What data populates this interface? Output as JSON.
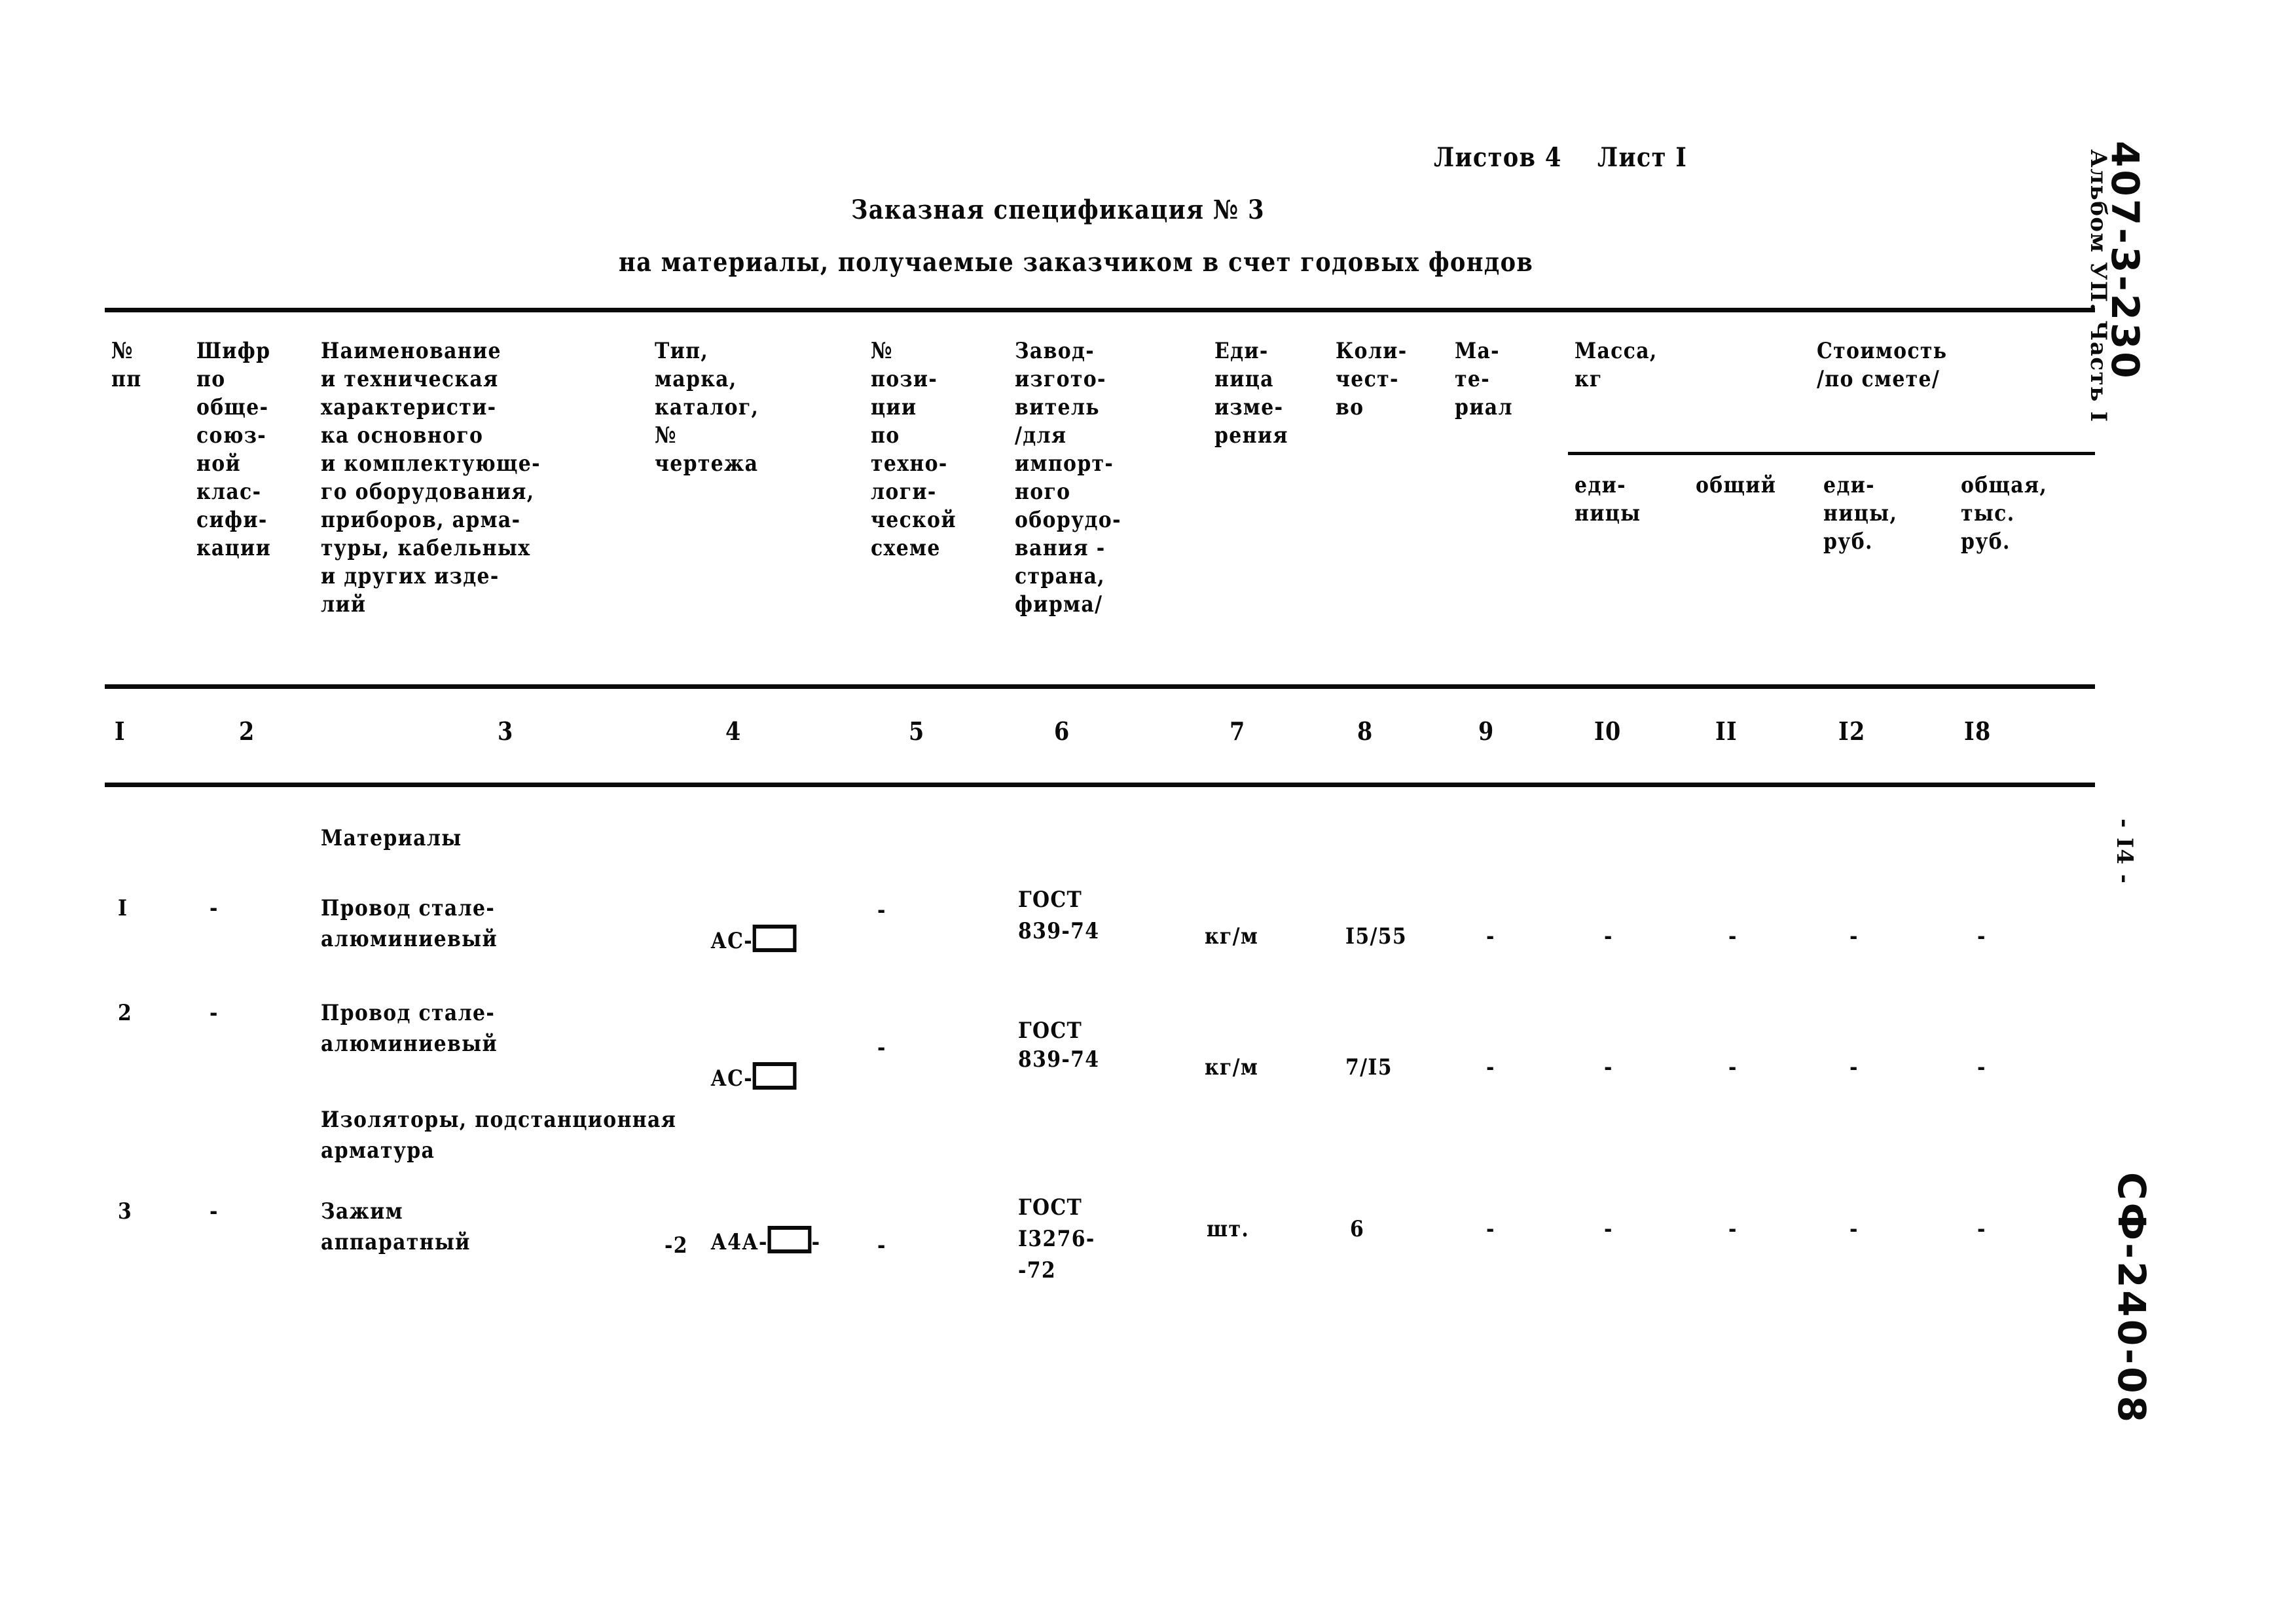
{
  "document": {
    "sheet_info": "Листов 4    Лист I",
    "title_line1": "Заказная спецификация № 3",
    "title_line2": "на материалы, получаемые заказчиком в счет годовых фондов"
  },
  "margin": {
    "album_code_handwritten": "407-3-230",
    "album_label": "Альбом УП. Часть I",
    "page_number": "- I4 -",
    "stamp_handwritten": "СФ-240-08"
  },
  "table": {
    "headers": [
      {
        "num": "I",
        "lines": [
          "№",
          "пп"
        ]
      },
      {
        "num": "2",
        "lines": [
          "Шифр",
          "по",
          "обще-",
          "союз-",
          "ной",
          "клас-",
          "сифи-",
          "кации"
        ]
      },
      {
        "num": "3",
        "lines": [
          "Наименование",
          "и техническая",
          "характеристи-",
          "ка основного",
          "и комплектующе-",
          "го оборудования,",
          "приборов, арма-",
          "туры, кабельных",
          "и других изде-",
          "лий"
        ]
      },
      {
        "num": "4",
        "lines": [
          "Тип,",
          "марка,",
          "каталог,",
          "№",
          "чертежа"
        ]
      },
      {
        "num": "5",
        "lines": [
          "№",
          "пози-",
          "ции",
          "по",
          "техно-",
          "логи-",
          "ческой",
          "схеме"
        ]
      },
      {
        "num": "6",
        "lines": [
          "Завод-",
          "изгото-",
          "витель",
          "/для",
          "импорт-",
          "ного",
          "оборудо-",
          "вания -",
          "страна,",
          "фирма/"
        ]
      },
      {
        "num": "7",
        "lines": [
          "Еди-",
          "ница",
          "изме-",
          "рения"
        ]
      },
      {
        "num": "8",
        "lines": [
          "Коли-",
          "чест-",
          "во"
        ]
      },
      {
        "num": "9",
        "lines": [
          "Ма-",
          "те-",
          "риал"
        ]
      },
      {
        "num": "I0",
        "lines": [
          "Масса,",
          "кг"
        ],
        "sub": [
          "еди-",
          "ницы"
        ]
      },
      {
        "num": "II",
        "lines": [],
        "sub": [
          "общий"
        ]
      },
      {
        "num": "I2",
        "lines": [
          "Стоимость",
          "/по смете/"
        ],
        "sub": [
          "еди-",
          "ницы,",
          "руб."
        ]
      },
      {
        "num": "I8",
        "lines": [],
        "sub": [
          "общая,",
          "тыс.",
          "руб."
        ]
      }
    ],
    "group_header_mass": "Масса,\nкг",
    "group_header_cost": "Стоимость\n/по смете/",
    "sub_headers": {
      "mass_unit": [
        "еди-",
        "ницы"
      ],
      "mass_total": [
        "общий"
      ],
      "cost_unit": [
        "еди-",
        "ницы,",
        "руб."
      ],
      "cost_total": [
        "общая,",
        "тыс.",
        "руб."
      ]
    },
    "column_numbers": [
      "I",
      "2",
      "3",
      "4",
      "5",
      "6",
      "7",
      "8",
      "9",
      "I0",
      "II",
      "I2",
      "I8"
    ],
    "section_1_title": "Материалы",
    "section_2_title_line1": "Изоляторы, подстанционная",
    "section_2_title_line2": "арматура",
    "rows": [
      {
        "num": "I",
        "code": "-",
        "name_line1": "Провод стале-",
        "name_line2": "алюминиевый",
        "type_prefix": "АС-",
        "type_suffix": "",
        "type_line2": "",
        "position": "-",
        "manufacturer_line1": "ГОСТ",
        "manufacturer_line2": "839-74",
        "manufacturer_line3": "",
        "unit": "кг/м",
        "qty": "I5/55",
        "material": "-",
        "mass_unit": "-",
        "mass_total": "-",
        "cost_unit": "-",
        "cost_total": "-"
      },
      {
        "num": "2",
        "code": "-",
        "name_line1": "Провод стале-",
        "name_line2": "алюминиевый",
        "type_prefix": "АС-",
        "type_suffix": "",
        "type_line2": "",
        "position": "-",
        "manufacturer_line1": "ГОСТ",
        "manufacturer_line2": "839-74",
        "manufacturer_line3": "",
        "unit": "кг/м",
        "qty": "7/I5",
        "material": "-",
        "mass_unit": "-",
        "mass_total": "-",
        "cost_unit": "-",
        "cost_total": "-"
      },
      {
        "num": "3",
        "code": "-",
        "name_line1": "Зажим",
        "name_line2": "аппаратный",
        "type_prefix": "А4А-",
        "type_suffix": "-",
        "type_line2": "-2",
        "position": "-",
        "manufacturer_line1": "ГОСТ",
        "manufacturer_line2": "I3276-",
        "manufacturer_line3": "-72",
        "unit": "шт.",
        "qty": "6",
        "material": "-",
        "mass_unit": "-",
        "mass_total": "-",
        "cost_unit": "-",
        "cost_total": "-"
      }
    ]
  }
}
